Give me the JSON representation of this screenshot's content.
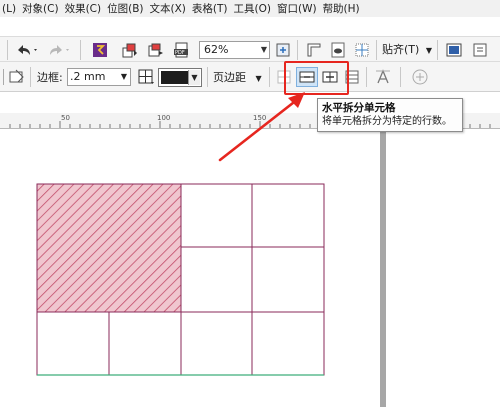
{
  "menubar": {
    "items": [
      "(L)",
      "对象(C)",
      "效果(C)",
      "位图(B)",
      "文本(X)",
      "表格(T)",
      "工具(O)",
      "窗口(W)",
      "帮助(H)"
    ]
  },
  "toolbar": {
    "zoom_value": "62%",
    "snap_label": "贴齐(T)",
    "icons": [
      "undo-icon",
      "redo-icon",
      "launcher-icon",
      "import-icon",
      "export-icon",
      "pdf-icon",
      "zoom-dropdown",
      "fullscreen-icon",
      "rulers-icon",
      "view-icon",
      "grid-icon",
      "options-icon",
      "more-icon"
    ]
  },
  "property_bar": {
    "border_label": "边框:",
    "border_width": ".2 mm",
    "border_color": "#1d1d1d",
    "margin_label": "页边距",
    "highlight_color": "#e6261f"
  },
  "tooltip": {
    "title": "水平拆分单元格",
    "description": "将单元格拆分为特定的行数。"
  },
  "ruler": {
    "labels": [
      "50",
      "100",
      "150"
    ]
  },
  "table": {
    "line_color": "#8a2a5a",
    "bottom_line_color": "#3fae7a",
    "hatch_color": "#c24d6a",
    "selected_fill": "#f0c6cf"
  }
}
